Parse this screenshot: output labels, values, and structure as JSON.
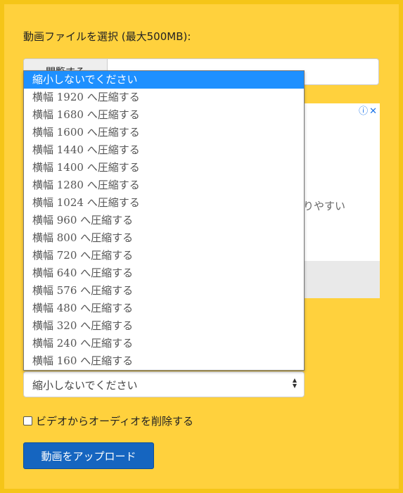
{
  "form": {
    "file_label": "動画ファイルを選択 (最大500MB):",
    "browse_label": "閲覧する",
    "resize_selected": "縮小しないでください",
    "resize_options": [
      "縮小しないでください",
      "横幅 1920 へ圧縮する",
      "横幅 1680 へ圧縮する",
      "横幅 1600 へ圧縮する",
      "横幅 1440 へ圧縮する",
      "横幅 1400 へ圧縮する",
      "横幅 1280 へ圧縮する",
      "横幅 1024 へ圧縮する",
      "横幅 960 へ圧縮する",
      "横幅 800 へ圧縮する",
      "横幅 720 へ圧縮する",
      "横幅 640 へ圧縮する",
      "横幅 576 へ圧縮する",
      "横幅 480 へ圧縮する",
      "横幅 320 へ圧縮する",
      "横幅 240 へ圧縮する",
      "横幅 160 へ圧縮する"
    ],
    "remove_audio_label": "ビデオからオーディオを削除する",
    "remove_audio_checked": false,
    "upload_label": "動画をアップロード"
  },
  "ad": {
    "partial_text": "りやすい",
    "info_icon": "info-icon",
    "close_icon": "close-icon"
  },
  "colors": {
    "background": "#f5c518",
    "panel": "#ffd13d",
    "selected_option": "#1e90ff",
    "upload_button": "#1565c0"
  }
}
